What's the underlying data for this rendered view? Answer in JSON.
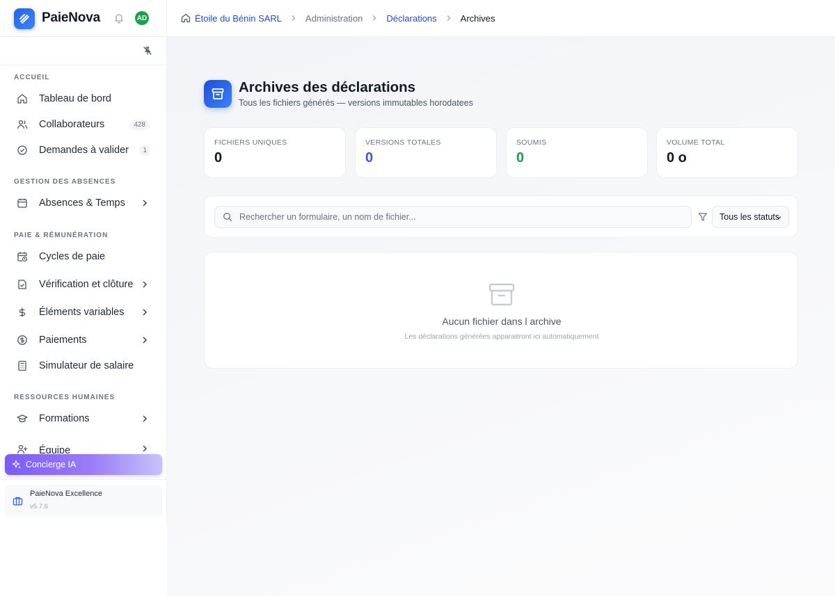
{
  "app": {
    "name": "PaieNova",
    "avatar_initials": "AD"
  },
  "breadcrumb": {
    "company": "Étoile du Bénin SARL",
    "section": "Administration",
    "parent": "Déclarations",
    "current": "Archives"
  },
  "sidebar": {
    "sections": {
      "accueil": "ACCUEIL",
      "absences": "GESTION DES ABSENCES",
      "paie": "PAIE & RÉMUNÉRATION",
      "rh": "RESSOURCES HUMAINES"
    },
    "items": [
      {
        "label": "Tableau de bord",
        "icon": "home-icon"
      },
      {
        "label": "Collaborateurs",
        "icon": "users-icon",
        "count": "428"
      },
      {
        "label": "Demandes à valider",
        "icon": "check-circle-icon",
        "count": "1"
      },
      {
        "label": "Absences & Temps",
        "icon": "calendar-icon"
      },
      {
        "label": "Cycles de paie",
        "icon": "calendar-clock-icon"
      },
      {
        "label": "Vérification et clôture",
        "icon": "file-check-icon"
      },
      {
        "label": "Éléments variables",
        "icon": "dollar-icon"
      },
      {
        "label": "Paiements",
        "icon": "coin-icon"
      },
      {
        "label": "Simulateur de salaire",
        "icon": "calculator-icon"
      },
      {
        "label": "Formations",
        "icon": "graduation-cap-icon"
      },
      {
        "label": "Équipe",
        "icon": "user-plus-icon"
      }
    ],
    "concierge": "Concierge IA",
    "footer": {
      "name": "PaieNova Excellence",
      "version": "v5.7.6"
    }
  },
  "page": {
    "title": "Archives des déclarations",
    "subtitle": "Tous les fichiers générés — versions immutables horodatees"
  },
  "stats": [
    {
      "label": "FICHIERS UNIQUES",
      "value": "0",
      "color": "#111827"
    },
    {
      "label": "VERSIONS TOTALES",
      "value": "0",
      "color": "#3b5bdb"
    },
    {
      "label": "SOUMIS",
      "value": "0",
      "color": "#16a34a"
    },
    {
      "label": "VOLUME TOTAL",
      "value": "0 o",
      "color": "#111827"
    }
  ],
  "filters": {
    "search_placeholder": "Rechercher un formulaire, un nom de fichier...",
    "status_value": "Tous les statuts"
  },
  "empty": {
    "title": "Aucun fichier dans l archive",
    "subtitle": "Les déclarations générées apparaitront ici automatiquement"
  }
}
